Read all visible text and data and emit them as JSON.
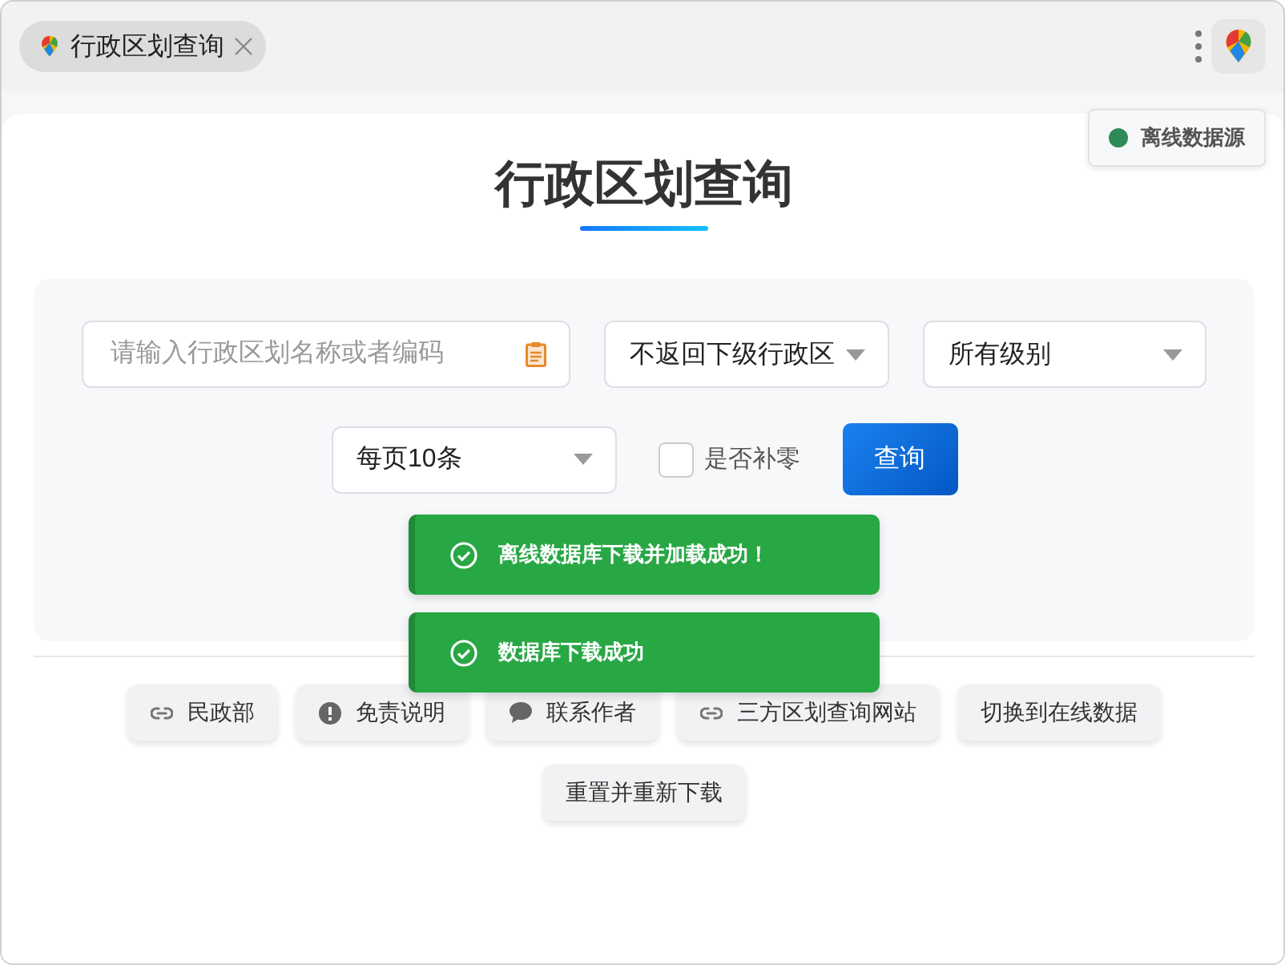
{
  "tab": {
    "title": "行政区划查询"
  },
  "source_badge": {
    "label": "离线数据源",
    "color": "#2e8b57"
  },
  "title": "行政区划查询",
  "form": {
    "search": {
      "placeholder": "请输入行政区划名称或者编码"
    },
    "child_select": {
      "value": "不返回下级行政区"
    },
    "level_select": {
      "value": "所有级别"
    },
    "page_size_select": {
      "value": "每页10条"
    },
    "zero_pad": {
      "label": "是否补零",
      "checked": false
    },
    "query_button": "查询"
  },
  "links": [
    {
      "label": "民政部",
      "kind": "link"
    },
    {
      "label": "免责说明",
      "kind": "alert"
    },
    {
      "label": "联系作者",
      "kind": "chat"
    },
    {
      "label": "三方区划查询网站",
      "kind": "link"
    },
    {
      "label": "切换到在线数据",
      "kind": "plain"
    },
    {
      "label": "重置并重新下载",
      "kind": "plain"
    }
  ],
  "toasts": [
    {
      "message": "离线数据库下载并加载成功！"
    },
    {
      "message": "数据库下载成功"
    }
  ]
}
